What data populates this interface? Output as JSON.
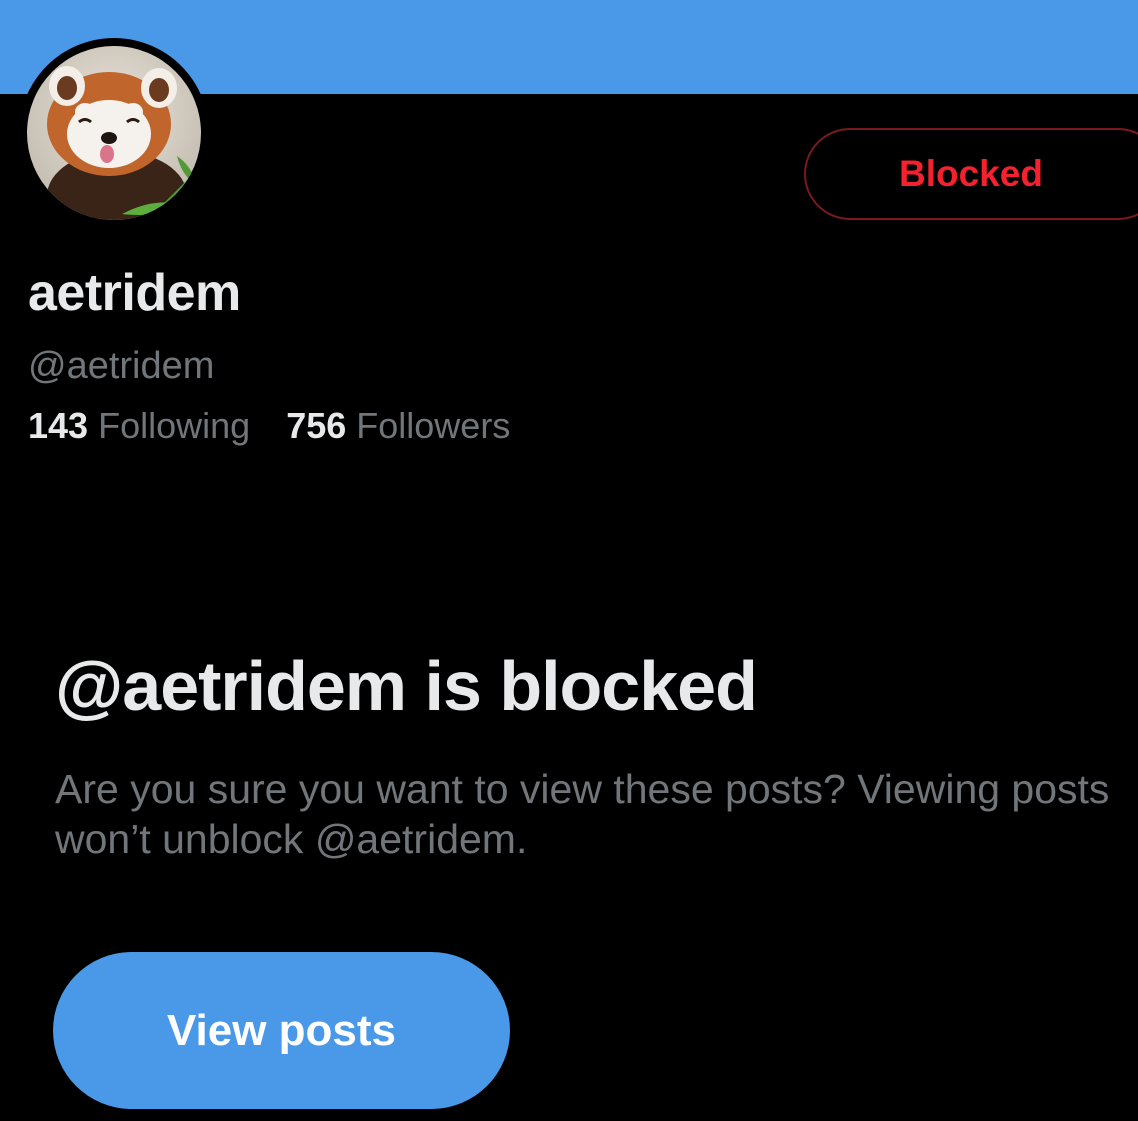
{
  "profile": {
    "display_name": "aetridem",
    "handle": "@aetridem",
    "avatar_icon": "red-panda-avatar",
    "stats": [
      {
        "count": "143",
        "label": "Following"
      },
      {
        "count": "756",
        "label": "Followers"
      }
    ]
  },
  "actions": {
    "blocked_label": "Blocked",
    "view_posts_label": "View posts"
  },
  "notice": {
    "title": "@aetridem is blocked",
    "description": "Are you sure you want to view these posts? Viewing posts won’t unblock @aetridem."
  },
  "colors": {
    "banner": "#4a99e9",
    "background": "#000000",
    "blocked_red": "#f4212e",
    "primary_button": "#4a99e9",
    "muted_text": "#71767b"
  }
}
